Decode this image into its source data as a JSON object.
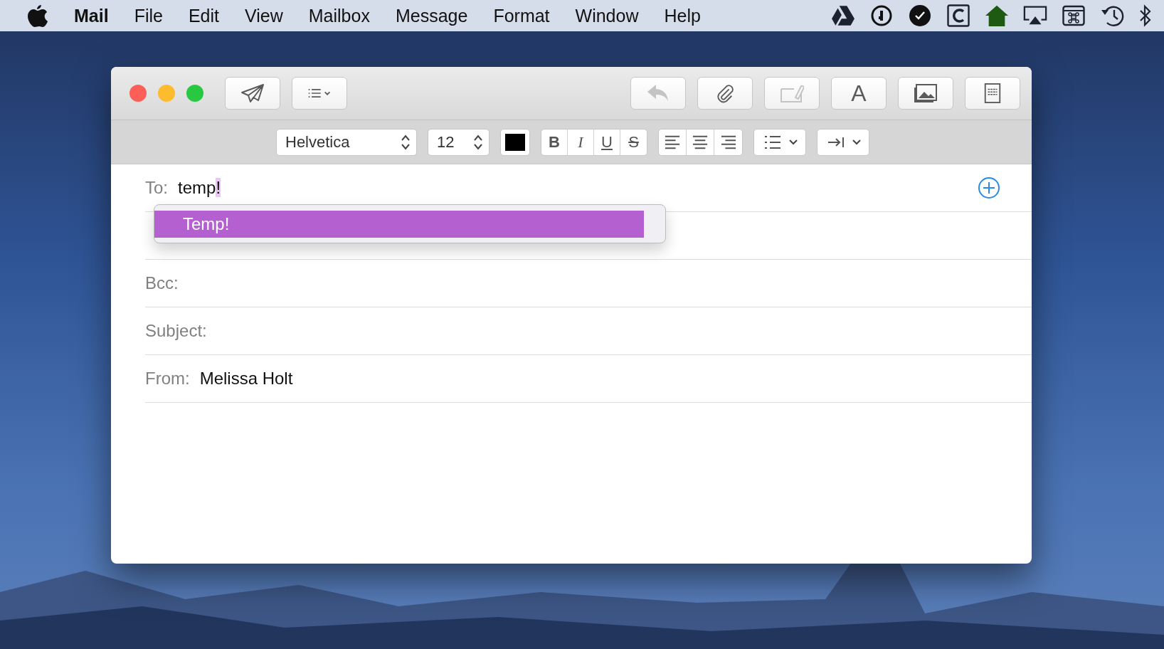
{
  "menu_bar": {
    "app_name": "Mail",
    "items": [
      "File",
      "Edit",
      "View",
      "Mailbox",
      "Message",
      "Format",
      "Window",
      "Help"
    ],
    "status_icons": [
      {
        "kind": "drive"
      },
      {
        "kind": "key"
      },
      {
        "kind": "check"
      },
      {
        "kind": "c"
      },
      {
        "kind": "house"
      },
      {
        "kind": "airplay"
      },
      {
        "kind": "command"
      },
      {
        "kind": "history"
      },
      {
        "kind": "bluetooth"
      }
    ]
  },
  "window": {
    "toolbar": {
      "left": [
        {
          "kind": "send",
          "disabled": false
        },
        {
          "kind": "headers",
          "disabled": false
        }
      ],
      "right": [
        {
          "kind": "reply",
          "disabled": true
        },
        {
          "kind": "attach",
          "disabled": false
        },
        {
          "kind": "markup",
          "disabled": true
        },
        {
          "kind": "fonts",
          "label": "A",
          "disabled": false
        },
        {
          "kind": "photos",
          "disabled": false
        },
        {
          "kind": "stationery",
          "disabled": false
        }
      ]
    },
    "format_bar": {
      "font": "Helvetica",
      "size": "12",
      "styles": [
        {
          "kind": "bold",
          "label": "B"
        },
        {
          "kind": "italic",
          "label": "I"
        },
        {
          "kind": "underline",
          "label": "U"
        },
        {
          "kind": "strike",
          "label": "S"
        }
      ],
      "alignments": [
        {
          "kind": "left",
          "selected": false
        },
        {
          "kind": "center",
          "selected": false
        },
        {
          "kind": "right",
          "selected": false
        }
      ]
    },
    "fields": [
      {
        "kind": "to",
        "label": "To:",
        "value": "temp",
        "selected_text": "!"
      },
      {
        "kind": "covered"
      },
      {
        "kind": "plain",
        "label": "Bcc:"
      },
      {
        "kind": "plain",
        "label": "Subject:"
      },
      {
        "kind": "plain",
        "label": "From:",
        "value": "Melissa Holt"
      }
    ],
    "autocomplete": [
      {
        "label": "Temp!",
        "selected": true
      }
    ]
  }
}
